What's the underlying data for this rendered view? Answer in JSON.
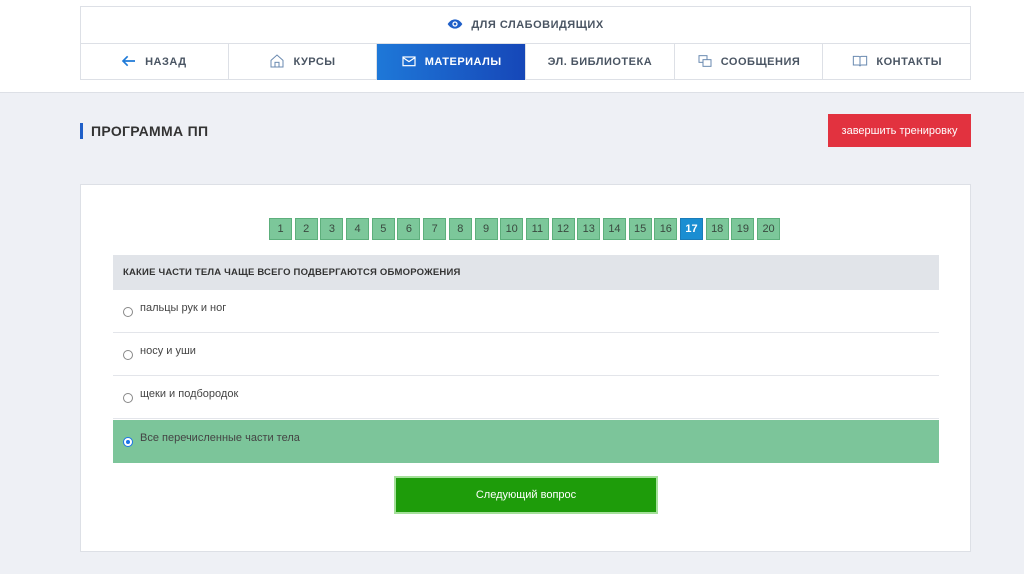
{
  "accessibility": {
    "label": "ДЛЯ СЛАБОВИДЯЩИХ",
    "icon": "eye-icon"
  },
  "nav": {
    "items": [
      {
        "label": "НАЗАД",
        "icon": "arrow-left-icon"
      },
      {
        "label": "КУРСЫ",
        "icon": "home-icon"
      },
      {
        "label": "МАТЕРИАЛЫ",
        "icon": "envelope-icon",
        "active": true
      },
      {
        "label": "ЭЛ. БИБЛИОТЕКА"
      },
      {
        "label": "СООБЩЕНИЯ",
        "icon": "messages-icon"
      },
      {
        "label": "КОНТАКТЫ",
        "icon": "book-icon"
      }
    ]
  },
  "page": {
    "title": "ПРОГРАММА ПП",
    "finish_button": "завершить тренировку"
  },
  "questions": {
    "numbers": [
      "1",
      "2",
      "3",
      "4",
      "5",
      "6",
      "7",
      "8",
      "9",
      "10",
      "11",
      "12",
      "13",
      "14",
      "15",
      "16",
      "17",
      "18",
      "19",
      "20"
    ],
    "current": "17"
  },
  "question": {
    "text": "КАКИЕ ЧАСТИ ТЕЛА ЧАЩЕ ВСЕГО ПОДВЕРГАЮТСЯ ОБМОРОЖЕНИЯ",
    "answers": [
      {
        "text": "пальцы рук и ног",
        "selected": false
      },
      {
        "text": "носу и уши",
        "selected": false
      },
      {
        "text": "щеки и подбородок",
        "selected": false
      },
      {
        "text": "Все перечисленные части тела",
        "selected": true
      }
    ]
  },
  "next_button": "Следующий вопрос",
  "colors": {
    "accent": "#1647b8",
    "danger": "#e2323f",
    "success": "#1e9c0a",
    "answer_selected": "#7cc59a",
    "current_question": "#1a8ed2"
  }
}
